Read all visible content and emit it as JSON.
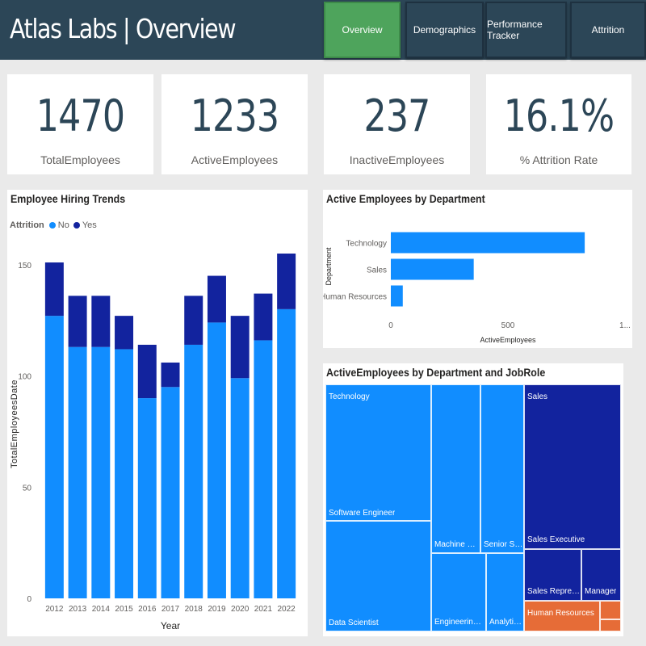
{
  "header": {
    "title": "Atlas Labs | Overview",
    "tabs": [
      {
        "label": "Overview",
        "active": true
      },
      {
        "label": "Demographics",
        "active": false
      },
      {
        "label": "Performance Tracker",
        "active": false
      },
      {
        "label": "Attrition",
        "active": false
      }
    ]
  },
  "kpis": [
    {
      "value": "1470",
      "label": "TotalEmployees"
    },
    {
      "value": "1233",
      "label": "ActiveEmployees"
    },
    {
      "value": "237",
      "label": "InactiveEmployees"
    },
    {
      "value": "16.1%",
      "label": "% Attrition Rate"
    }
  ],
  "colors": {
    "no": "#118dff",
    "yes": "#12239e",
    "header": "#2c4657",
    "tab_active": "#4ea45c",
    "hr": "#e66c37"
  },
  "hiring_chart": {
    "title": "Employee Hiring Trends",
    "legend_title": "Attrition",
    "legend": [
      "No",
      "Yes"
    ]
  },
  "dept_chart": {
    "title": "Active Employees by Department"
  },
  "treemap_chart": {
    "title": "ActiveEmployees by Department and JobRole",
    "departments": [
      "Technology",
      "Sales",
      "Human Resources"
    ],
    "roles": [
      "Software Engineer",
      "Data Scientist",
      "Machine Lear...",
      "Engineering Ma...",
      "Senior Softw...",
      "Analytics ...",
      "Sales Executive",
      "Sales Representat...",
      "Manager"
    ]
  },
  "chart_data": [
    {
      "type": "bar",
      "stacked": true,
      "title": "Employee Hiring Trends",
      "xlabel": "Year",
      "ylabel": "TotalEmployeesDate",
      "categories": [
        "2012",
        "2013",
        "2014",
        "2015",
        "2016",
        "2017",
        "2018",
        "2019",
        "2020",
        "2021",
        "2022"
      ],
      "series": [
        {
          "name": "No",
          "values": [
            127,
            113,
            113,
            112,
            90,
            95,
            114,
            124,
            99,
            116,
            130
          ]
        },
        {
          "name": "Yes",
          "values": [
            24,
            23,
            23,
            15,
            24,
            11,
            22,
            21,
            28,
            21,
            25
          ]
        }
      ],
      "ylim": [
        0,
        155
      ],
      "yticks": [
        0,
        50,
        100,
        150
      ],
      "legend_title": "Attrition",
      "legend_position": "top-left"
    },
    {
      "type": "bar",
      "orientation": "horizontal",
      "title": "Active Employees by Department",
      "categories": [
        "Technology",
        "Sales",
        "Human Resources"
      ],
      "values": [
        828,
        354,
        51
      ],
      "xlabel": "ActiveEmployees",
      "ylabel": "Department",
      "xlim": [
        0,
        1000
      ],
      "xticks": [
        "0",
        "500",
        "1..."
      ]
    }
  ]
}
